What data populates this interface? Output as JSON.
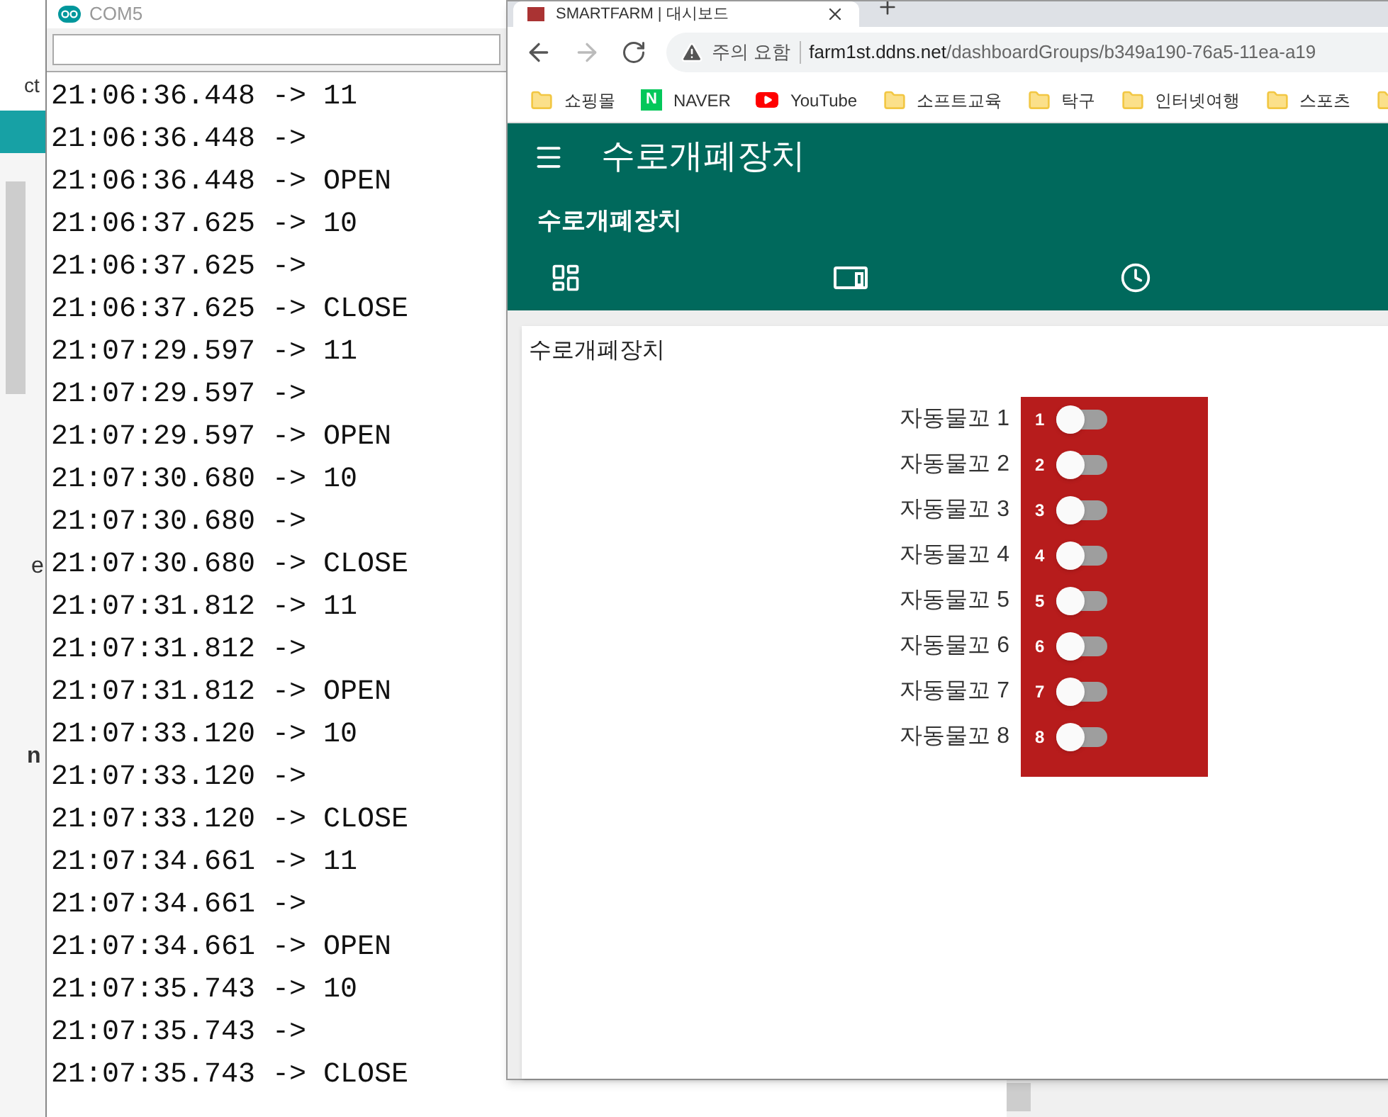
{
  "background_app": {
    "fragments": [
      "ct",
      "e",
      "n"
    ]
  },
  "serial_monitor": {
    "title": "COM5",
    "log": [
      "21:06:36.448 -> 11",
      "21:06:36.448 ->",
      "21:06:36.448 -> OPEN",
      "21:06:37.625 -> 10",
      "21:06:37.625 ->",
      "21:06:37.625 -> CLOSE",
      "21:07:29.597 -> 11",
      "21:07:29.597 ->",
      "21:07:29.597 -> OPEN",
      "21:07:30.680 -> 10",
      "21:07:30.680 ->",
      "21:07:30.680 -> CLOSE",
      "21:07:31.812 -> 11",
      "21:07:31.812 ->",
      "21:07:31.812 -> OPEN",
      "21:07:33.120 -> 10",
      "21:07:33.120 ->",
      "21:07:33.120 -> CLOSE",
      "21:07:34.661 -> 11",
      "21:07:34.661 ->",
      "21:07:34.661 -> OPEN",
      "21:07:35.743 -> 10",
      "21:07:35.743 ->",
      "21:07:35.743 -> CLOSE"
    ]
  },
  "browser": {
    "tab_title": "SMARTFARM | 대시보드",
    "security": "주의 요함",
    "url_host": "farm1st.ddns.net",
    "url_path": "/dashboardGroups/b349a190-76a5-11ea-a19",
    "bookmarks": [
      {
        "kind": "folder",
        "label": "쇼핑몰"
      },
      {
        "kind": "naver",
        "logo_letter": "N",
        "label": "NAVER"
      },
      {
        "kind": "youtube",
        "label": "YouTube"
      },
      {
        "kind": "folder",
        "label": "소프트교육"
      },
      {
        "kind": "folder",
        "label": "탁구"
      },
      {
        "kind": "folder",
        "label": "인터넷여행"
      },
      {
        "kind": "folder",
        "label": "스포츠"
      },
      {
        "kind": "folder"
      }
    ],
    "app_title": "수로개폐장치",
    "group_title": "수로개폐장치",
    "card": {
      "title": "수로개폐장치",
      "switches": [
        {
          "label": "자동물꼬 1",
          "number": "1",
          "on": false
        },
        {
          "label": "자동물꼬 2",
          "number": "2",
          "on": false
        },
        {
          "label": "자동물꼬 3",
          "number": "3",
          "on": false
        },
        {
          "label": "자동물꼬 4",
          "number": "4",
          "on": false
        },
        {
          "label": "자동물꼬 5",
          "number": "5",
          "on": false
        },
        {
          "label": "자동물꼬 6",
          "number": "6",
          "on": false
        },
        {
          "label": "자동물꼬 7",
          "number": "7",
          "on": false
        },
        {
          "label": "자동물꼬 8",
          "number": "8",
          "on": false
        }
      ]
    }
  }
}
